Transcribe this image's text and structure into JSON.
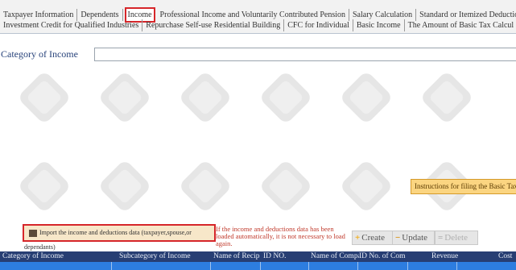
{
  "tabs": {
    "row1": [
      "Taxpayer Information",
      "Dependents",
      "Income",
      "Professional Income and Voluntarily Contributed Pension",
      "Salary Calculation",
      "Standard or Itemized Deduction"
    ],
    "row2": [
      "Investment Credit for Qualified Industries",
      "Repurchase Self-use Residential Building",
      "CFC for Individual",
      "Basic Income",
      "The Amount of Basic Tax Calcul"
    ],
    "active": "Income"
  },
  "category": {
    "label": "Category of Income",
    "value": ""
  },
  "instructions_label": "Instructions for filing the Basic Tax",
  "import_button_label": "Import the income and deductions data (taxpayer,spouse,or dependants)",
  "auto_load_note": "If the income and deductions data has been loaded automatically, it is not necessary to load again.",
  "actions": {
    "create": "Create",
    "update": "Update",
    "delete": "Delete"
  },
  "table": {
    "columns": [
      "Category of Income",
      "Subcategory of Income",
      "Name of Recip",
      "ID NO.",
      "Name of Compa",
      "ID No. of Com",
      "Revenue",
      "Cost"
    ]
  },
  "colors": {
    "active_tab_border": "#d6262a",
    "header_bg": "#273e73",
    "row_bg": "#2d7de0",
    "instructions_bg": "#fbd581",
    "note_text": "#c0392b"
  }
}
